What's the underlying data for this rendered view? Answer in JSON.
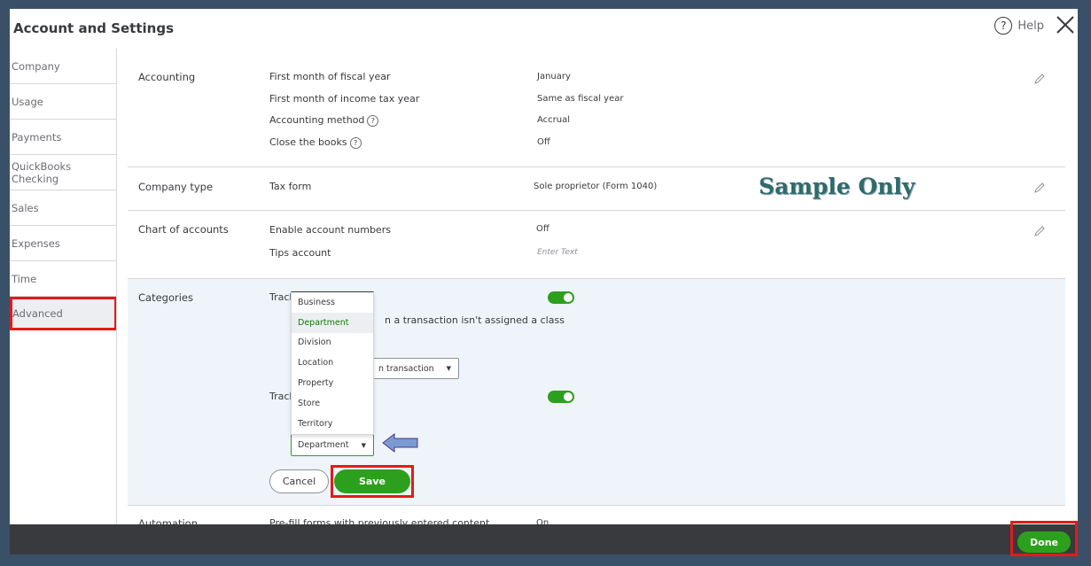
{
  "modal": {
    "title": "Account and Settings",
    "help_label": "Help"
  },
  "sidebar": {
    "items": [
      {
        "label": "Company"
      },
      {
        "label": "Usage"
      },
      {
        "label": "Payments"
      },
      {
        "label": "QuickBooks Checking"
      },
      {
        "label": "Sales"
      },
      {
        "label": "Expenses"
      },
      {
        "label": "Time"
      },
      {
        "label": "Advanced"
      }
    ],
    "active": "Advanced"
  },
  "accounting": {
    "title": "Accounting",
    "rows": [
      {
        "label": "First month of fiscal year",
        "value": "January"
      },
      {
        "label": "First month of income tax year",
        "value": "Same as fiscal year"
      },
      {
        "label": "Accounting method",
        "value": "Accrual"
      },
      {
        "label": "Close the books",
        "value": "Off"
      }
    ]
  },
  "company_type": {
    "title": "Company type",
    "label": "Tax form",
    "value": "Sole proprietor (Form 1040)"
  },
  "chart_of_accounts": {
    "title": "Chart of accounts",
    "rows": [
      {
        "label": "Enable account numbers",
        "value": "Off"
      },
      {
        "label": "Tips account",
        "placeholder": "Enter Text"
      }
    ]
  },
  "categories": {
    "title": "Categories",
    "track1_label": "Track",
    "warn_text": "n a transaction isn't assigned a class",
    "class_select_value": "n transaction",
    "track2_label": "Track",
    "location_select_value": "Department",
    "dropdown_options": [
      "Business",
      "Department",
      "Division",
      "Location",
      "Property",
      "Store",
      "Territory"
    ],
    "dropdown_selected": "Department",
    "cancel_label": "Cancel",
    "save_label": "Save"
  },
  "automation": {
    "title": "Automation",
    "label": "Pre-fill forms with previously entered content",
    "value": "On"
  },
  "watermark": "Sample Only",
  "footer": {
    "done_label": "Done"
  },
  "colors": {
    "accent": "#2ca01c",
    "highlight": "#e5191a",
    "background": "#3a5068",
    "footer": "#393a3d",
    "arrow": "#7b9ad3"
  }
}
